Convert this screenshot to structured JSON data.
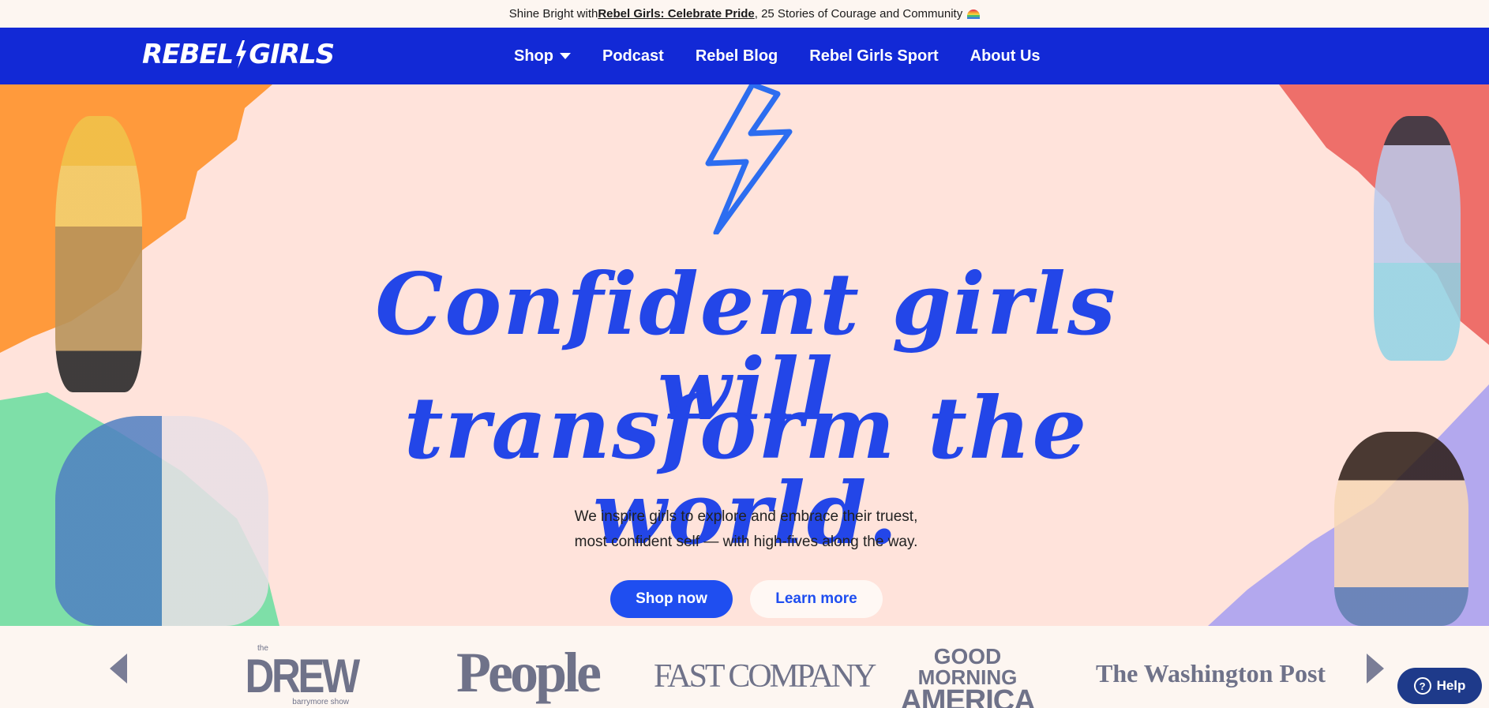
{
  "announcement": {
    "prefix": "Shine Bright with ",
    "link": "Rebel Girls: Celebrate Pride",
    "suffix": ", 25 Stories of Courage and Community"
  },
  "nav": {
    "logo": "REBEL GIRLS",
    "logo_left": "REBEL",
    "logo_right": "GIRLS",
    "items": [
      "Shop",
      "Podcast",
      "Rebel Blog",
      "Rebel Girls Sport",
      "About Us"
    ]
  },
  "hero": {
    "headline_line1": "Confident girls will",
    "headline_line2": "transform the world.",
    "subtitle_line1": "We inspire girls to explore and embrace their truest,",
    "subtitle_line2": "most confident self — with high-fives along the way.",
    "primary_button": "Shop now",
    "secondary_button": "Learn more"
  },
  "press": {
    "drew_the": "the",
    "drew_main": "DREW",
    "drew_sub": "barrymore show",
    "people": "People",
    "fast_company": "FAST COMPANY",
    "gma_line1": "GOOD",
    "gma_line2": "MORNING",
    "gma_line3": "AMERICA",
    "washington_post": "The Washington Post"
  },
  "help": {
    "label": "Help"
  },
  "colors": {
    "nav_blue": "#1229d6",
    "hero_pink": "#ffe3db",
    "headline_blue": "#2346e8",
    "orange": "#ff9a3c",
    "green": "#7edfa8",
    "coral": "#ee6f6a",
    "lavender": "#b3a8ee"
  }
}
